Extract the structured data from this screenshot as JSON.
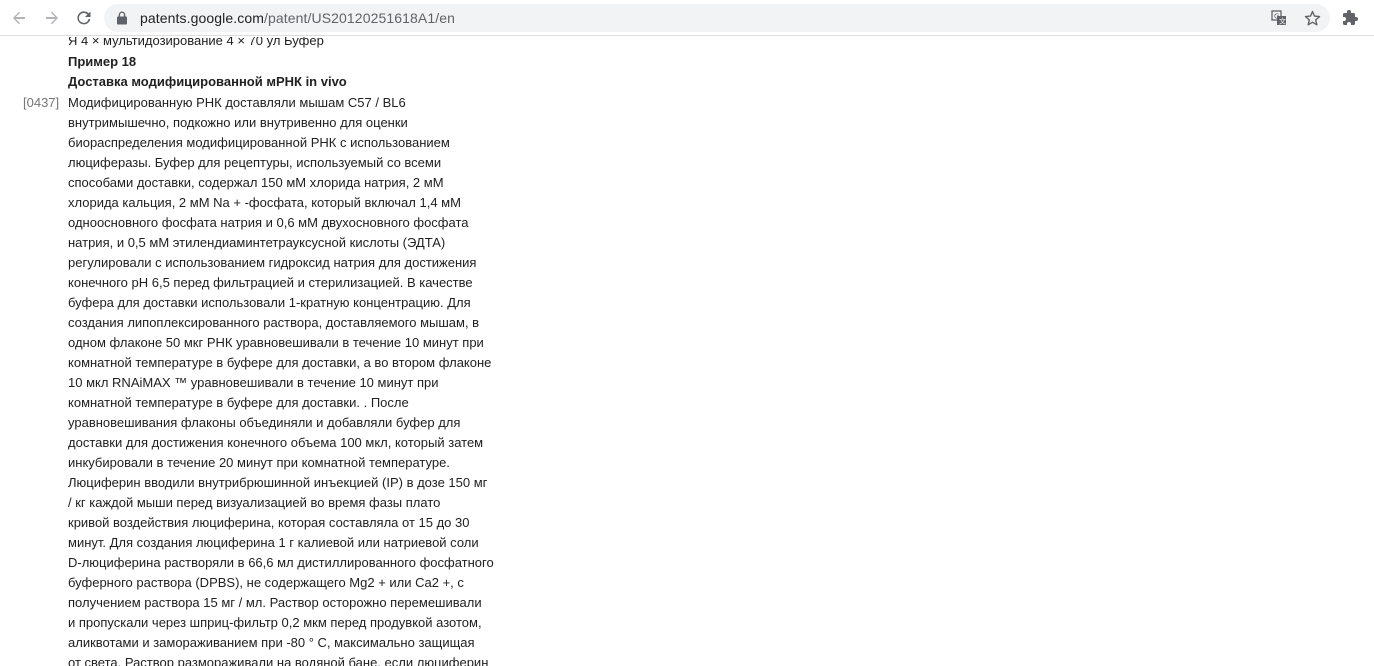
{
  "browser": {
    "url_host": "patents.google.com",
    "url_path": "/patent/US20120251618A1/en",
    "icons": {
      "back": "back-arrow-icon",
      "forward": "forward-arrow-icon",
      "reload": "reload-icon",
      "lock": "lock-icon",
      "translate": "translate-icon",
      "bookmark": "star-icon",
      "extensions": "puzzle-icon"
    }
  },
  "document": {
    "cut_line": "Я 4 × мультидозирование 4 × 70 ул Буфер",
    "example_heading": "Пример 18",
    "section_heading": "Доставка модифицированной мРНК in vivo",
    "paragraph_number": "[0437]",
    "paragraph_lines": [
      "Модифицированную РНК доставляли мышам C57 / BL6",
      "внутримышечно, подкожно или внутривенно для оценки",
      "биораспределения модифицированной РНК с использованием",
      "люциферазы. Буфер для рецептуры, используемый со всеми",
      "способами доставки, содержал 150 мМ хлорида натрия, 2 мМ",
      "хлорида кальция, 2 мМ Na + -фосфата, который включал 1,4 мМ",
      "одноосновного фосфата натрия и 0,6 мМ двухосновного фосфата",
      "натрия, и 0,5 мМ этилендиаминтетрауксусной кислоты (ЭДТА)",
      "регулировали с использованием гидроксид натрия для достижения",
      "конечного pH 6,5 перед фильтрацией и стерилизацией. В качестве",
      "буфера для доставки использовали 1-кратную концентрацию. Для",
      "создания липоплексированного раствора, доставляемого мышам, в",
      "одном флаконе 50 мкг РНК уравновешивали в течение 10 минут при",
      "комнатной температуре в буфере для доставки, а во втором флаконе",
      "10 мкл RNAiMAX ™ уравновешивали в течение 10 минут при",
      "комнатной температуре в буфере для доставки. . После",
      "уравновешивания флаконы объединяли и добавляли буфер для",
      "доставки для достижения конечного объема 100 мкл, который затем",
      "инкубировали в течение 20 минут при комнатной температуре.",
      "Люциферин вводили внутрибрюшинной инъекцией (IP) в дозе 150 мг",
      "/ кг каждой мыши перед визуализацией во время фазы плато",
      "кривой воздействия люциферина, которая составляла от 15 до 30",
      "минут. Для создания люциферина 1 г калиевой или натриевой соли",
      "D-люциферина растворяли в 66,6 мл дистиллированного фосфатного",
      "буферного раствора (DPBS), не содержащего Mg2 + или Ca2 +, с",
      "получением раствора 15 мг / мл. Раствор осторожно перемешивали",
      "и пропускали через шприц-фильтр 0,2 мкм перед продувкой азотом,",
      "аликвотами и замораживанием при -80 ° C, максимально защищая",
      "от света. Раствор размораживали на водяной бане, если люциферин"
    ]
  }
}
